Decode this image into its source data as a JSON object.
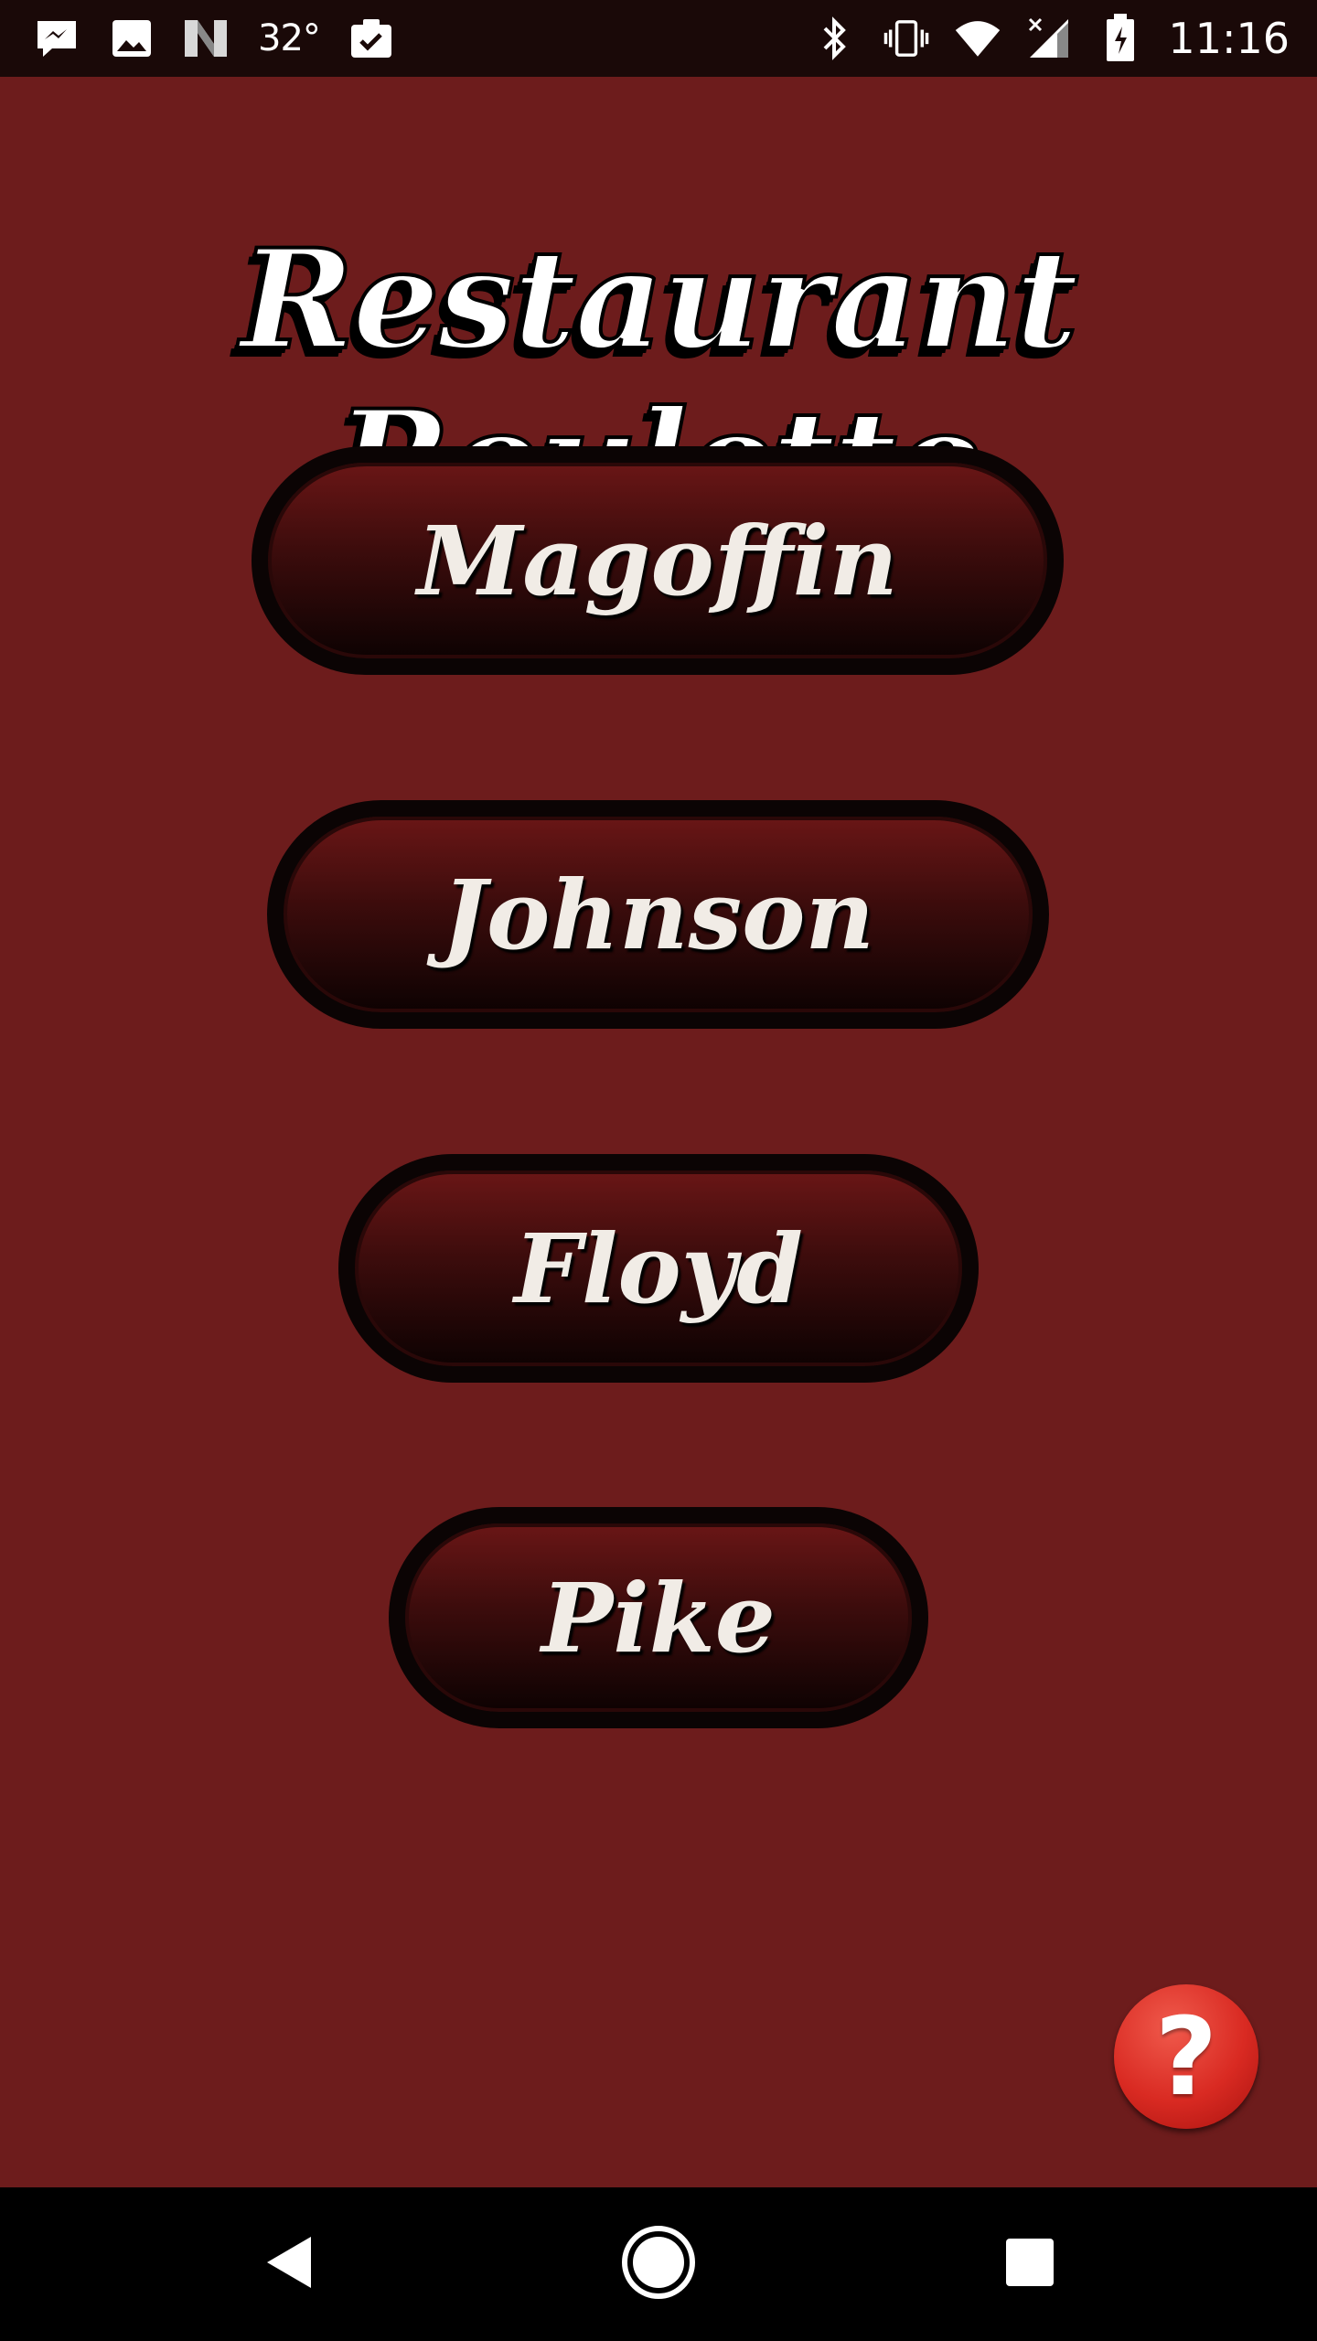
{
  "status_bar": {
    "temperature": "32°",
    "time": "11:16",
    "left_icons": [
      "messenger-icon",
      "image-icon",
      "news-icon",
      "weather-temp",
      "clipboard-check-icon"
    ],
    "right_icons": [
      "bluetooth-icon",
      "vibrate-icon",
      "wifi-icon",
      "cell-signal-icon",
      "battery-charging-icon"
    ]
  },
  "app": {
    "title": "Restaurant Roulette",
    "buttons": [
      {
        "label": "Magoffin"
      },
      {
        "label": "Johnson"
      },
      {
        "label": "Floyd"
      },
      {
        "label": "Pike"
      }
    ],
    "help_label": "?"
  },
  "nav_bar": {
    "icons": [
      "back-icon",
      "home-icon",
      "recents-icon"
    ]
  },
  "colors": {
    "background": "#6d1c1c",
    "status_bar": "#1a0908",
    "button_border": "#0b0404",
    "help_button": "#d92a22"
  }
}
